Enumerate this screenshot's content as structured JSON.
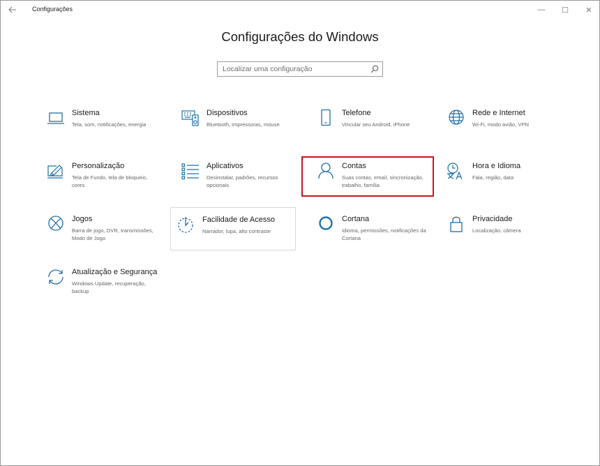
{
  "window": {
    "title": "Configurações",
    "back_icon": "back-arrow-icon",
    "controls": {
      "minimize": "—",
      "maximize": "☐",
      "close": "✕"
    }
  },
  "page": {
    "title": "Configurações do Windows"
  },
  "search": {
    "placeholder": "Localizar uma configuração",
    "value": ""
  },
  "accent_color": "#1f6fa8",
  "highlight_color": "#c8141e",
  "tiles": [
    {
      "id": "sistema",
      "name": "Sistema",
      "desc": "Tela, som, notificações, energia",
      "icon": "laptop-icon"
    },
    {
      "id": "dispositivos",
      "name": "Dispositivos",
      "desc": "Bluetooth, impressoras, mouse",
      "icon": "keyboard-speaker-icon"
    },
    {
      "id": "telefone",
      "name": "Telefone",
      "desc": "Vincular seu Android, iPhone",
      "icon": "phone-icon"
    },
    {
      "id": "rede",
      "name": "Rede e Internet",
      "desc": "Wi-Fi, modo avião, VPN",
      "icon": "globe-icon"
    },
    {
      "id": "personalizacao",
      "name": "Personalização",
      "desc": "Tela de Fundo, tela de bloqueio, cores",
      "icon": "paint-monitor-icon"
    },
    {
      "id": "aplicativos",
      "name": "Aplicativos",
      "desc": "Desinstalar, padrões, recursos opcionais",
      "icon": "app-list-icon"
    },
    {
      "id": "contas",
      "name": "Contas",
      "desc": "Suas contas, email, sincronização, trabalho, família",
      "icon": "person-icon"
    },
    {
      "id": "hora",
      "name": "Hora e Idioma",
      "desc": "Fala, região, data",
      "icon": "time-language-icon"
    },
    {
      "id": "jogos",
      "name": "Jogos",
      "desc": "Barra de jogo, DVR, transmissões, Modo de Jogo",
      "icon": "xbox-icon"
    },
    {
      "id": "facilidade",
      "name": "Facilidade de Acesso",
      "desc": "Narrador, lupa, alto contraste",
      "icon": "ease-of-access-icon"
    },
    {
      "id": "cortana",
      "name": "Cortana",
      "desc": "Idioma, permissões, notificações da Cortana",
      "icon": "cortana-circle-icon"
    },
    {
      "id": "privacidade",
      "name": "Privacidade",
      "desc": "Localização, câmera",
      "icon": "lock-icon"
    },
    {
      "id": "atualizacao",
      "name": "Atualização e Segurança",
      "desc": "Windows Update, recuperação, backup",
      "icon": "sync-arrows-icon"
    }
  ]
}
